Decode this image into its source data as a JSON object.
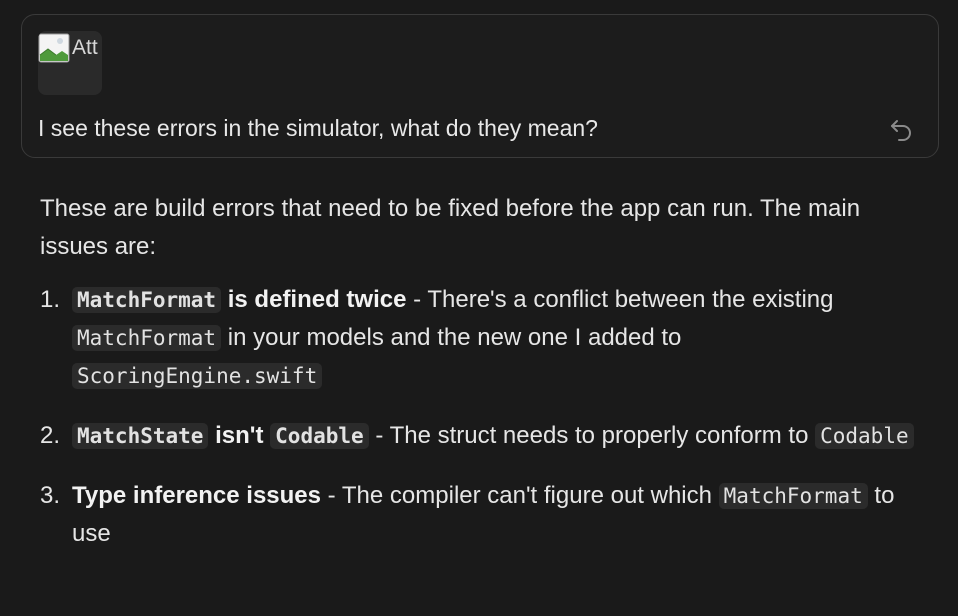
{
  "user_message": {
    "attachment_alt": "Att",
    "text": "I see these errors in the simulator, what do they mean?"
  },
  "response": {
    "intro": "These are build errors that need to be fixed before the app can run. The main issues are:",
    "items": [
      {
        "number": "1.",
        "code_bold": "MatchFormat",
        "bold_rest": " is defined twice",
        "text_a": " - There's a conflict between the existing ",
        "code_a": "MatchFormat",
        "text_b": " in your models and the new one I added to ",
        "code_b": "ScoringEngine.swift"
      },
      {
        "number": "2.",
        "code_bold": "MatchState",
        "bold_mid": " isn't ",
        "code_bold_2": "Codable",
        "text_a": " - The struct needs to properly conform to ",
        "code_a": "Codable"
      },
      {
        "number": "3.",
        "bold": "Type inference issues",
        "text_a": " - The compiler can't figure out which ",
        "code_a": "MatchFormat",
        "text_b": " to use"
      }
    ]
  },
  "icons": {
    "reply": "reply-icon",
    "broken_image": "broken-image-icon"
  },
  "colors": {
    "background": "#1a1a1a",
    "card_border": "#3a3a3a",
    "code_bg": "#2b2b2b",
    "text": "#e6e6e6"
  }
}
